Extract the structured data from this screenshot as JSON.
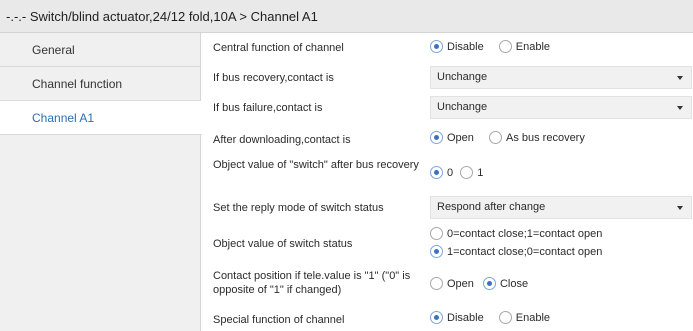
{
  "window": {
    "title": "-.-.- Switch/blind actuator,24/12 fold,10A > Channel A1"
  },
  "sidebar": {
    "items": [
      {
        "label": "General"
      },
      {
        "label": "Channel function"
      },
      {
        "label": "Channel A1"
      }
    ],
    "active_item": "Channel A1"
  },
  "params": {
    "central_function": {
      "label": "Central function of channel",
      "options": [
        "Disable",
        "Enable"
      ],
      "selected": "Disable"
    },
    "bus_recovery": {
      "label": "If bus recovery,contact is",
      "value": "Unchange"
    },
    "bus_failure": {
      "label": "If bus failure,contact is",
      "value": "Unchange"
    },
    "after_downloading": {
      "label": "After downloading,contact is",
      "options": [
        "Open",
        "As bus recovery"
      ],
      "selected": "Open"
    },
    "object_value_switch": {
      "label": "Object value of \"switch\" after bus recovery",
      "options": [
        "0",
        "1"
      ],
      "selected": "0"
    },
    "reply_mode": {
      "label": "Set the reply mode of switch status",
      "value": "Respond after change"
    },
    "switch_status": {
      "label": "Object value of switch status",
      "options": [
        "0=contact close;1=contact open",
        "1=contact close;0=contact open"
      ],
      "selected": "1=contact close;0=contact open"
    },
    "contact_position": {
      "label": "Contact position if tele.value is \"1\" (\"0\" is opposite of \"1\" if changed)",
      "options": [
        "Open",
        "Close"
      ],
      "selected": "Close"
    },
    "special_function": {
      "label": "Special function of channel",
      "options": [
        "Disable",
        "Enable"
      ],
      "selected": "Disable"
    }
  },
  "icons": {
    "dropdown": "chevron-down-icon",
    "radio": "radio-button-icon"
  },
  "colors": {
    "accent": "#3b73c1",
    "active_nav_text": "#2a6fb5",
    "dropdown_bg": "#f1f1f1"
  }
}
